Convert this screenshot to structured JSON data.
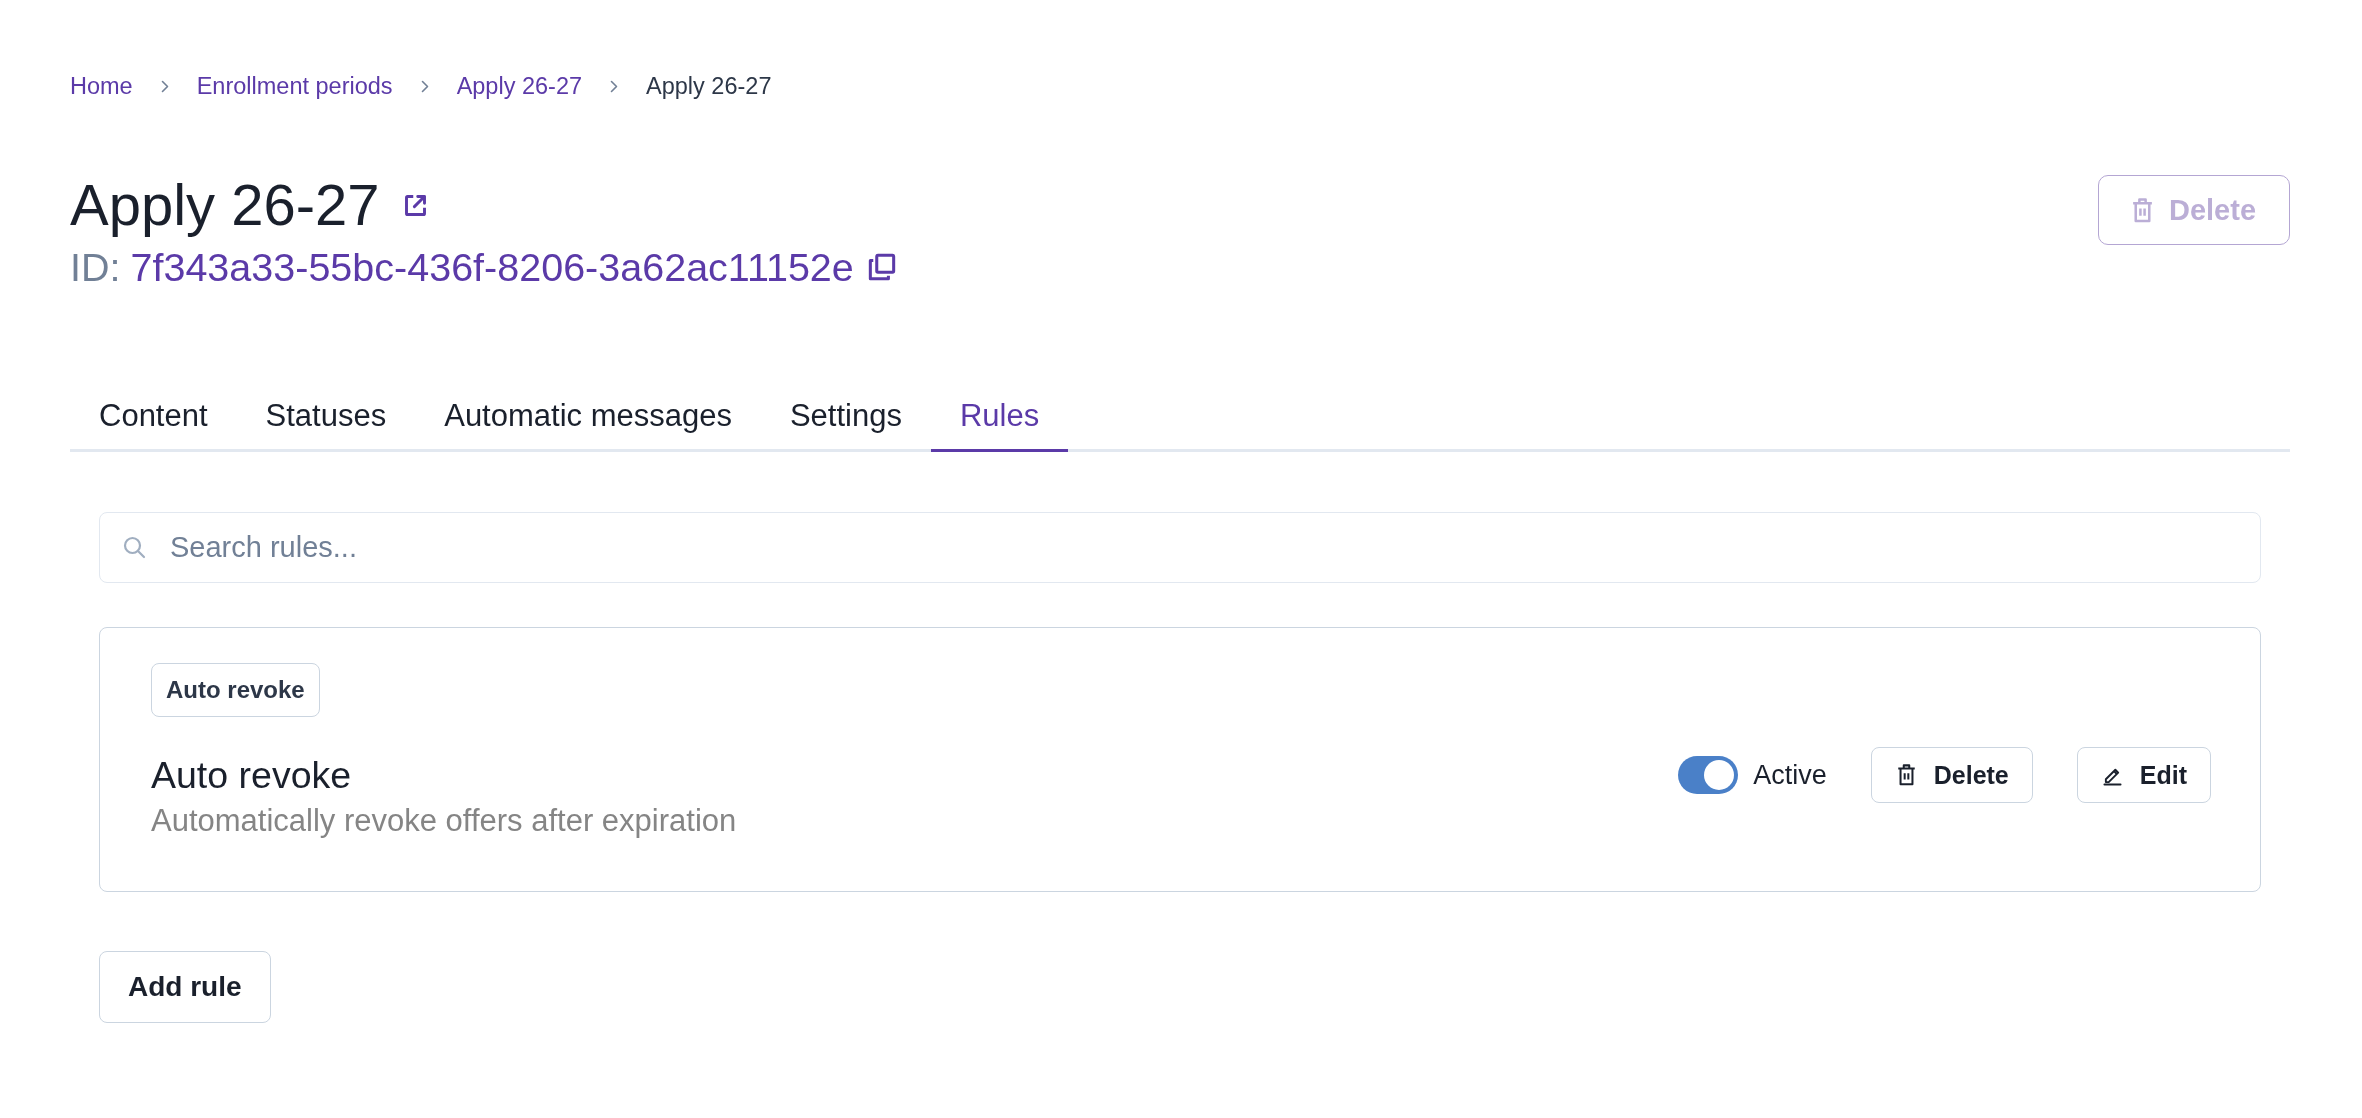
{
  "breadcrumb": [
    {
      "label": "Home",
      "current": false
    },
    {
      "label": "Enrollment periods",
      "current": false
    },
    {
      "label": "Apply 26-27",
      "current": false
    },
    {
      "label": "Apply 26-27",
      "current": true
    }
  ],
  "header": {
    "title": "Apply 26-27",
    "id_label": "ID:",
    "id_value": "7f343a33-55bc-436f-8206-3a62ac11152e",
    "delete_button": {
      "label": "Delete",
      "disabled": true
    }
  },
  "tabs": [
    {
      "label": "Content",
      "selected": false
    },
    {
      "label": "Statuses",
      "selected": false
    },
    {
      "label": "Automatic messages",
      "selected": false
    },
    {
      "label": "Settings",
      "selected": false
    },
    {
      "label": "Rules",
      "selected": true
    }
  ],
  "search": {
    "placeholder": "Search rules..."
  },
  "rules": [
    {
      "tag": "Auto revoke",
      "name": "Auto revoke",
      "description": "Automatically revoke offers after expiration",
      "on": true,
      "status_label": "Active",
      "actions": [
        {
          "kind": "delete",
          "label": "Delete"
        },
        {
          "kind": "edit",
          "label": "Edit"
        }
      ]
    }
  ],
  "add_button": {
    "label": "Add rule"
  }
}
